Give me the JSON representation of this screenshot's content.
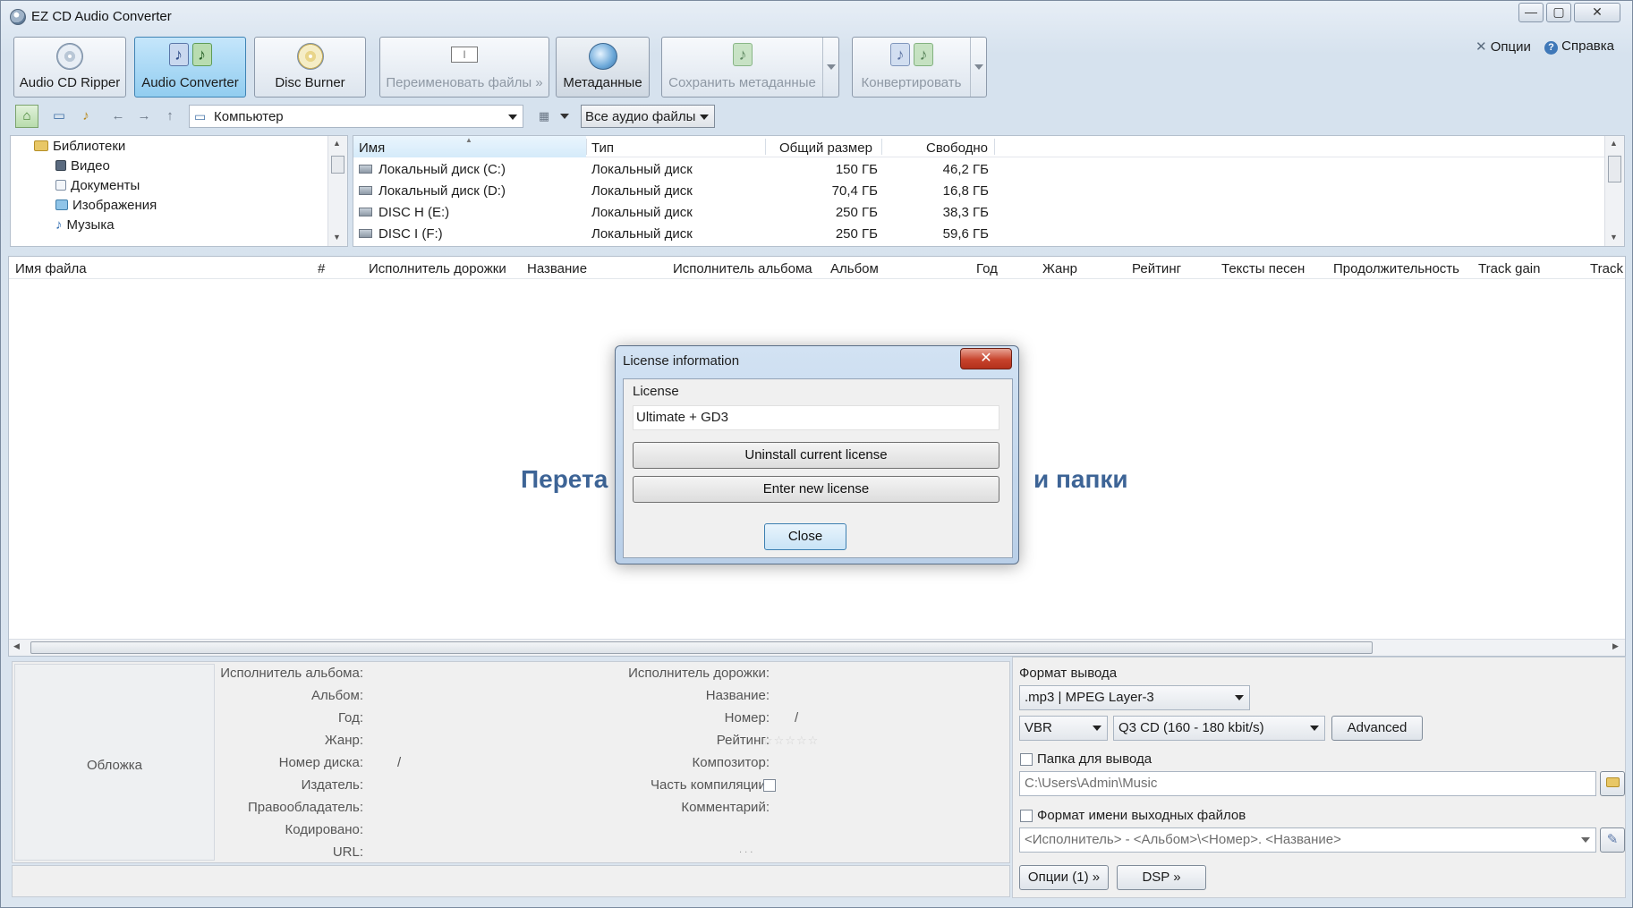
{
  "window": {
    "title": "EZ CD Audio Converter",
    "minimize": "—",
    "maximize": "▢",
    "close": "✕"
  },
  "toolbar": {
    "ripper": "Audio CD Ripper",
    "converter": "Audio Converter",
    "burner": "Disc Burner",
    "rename": "Переименовать файлы »",
    "metadata": "Метаданные",
    "save_metadata": "Сохранить метаданные",
    "convert": "Конвертировать",
    "options": "Опции",
    "help": "Справка"
  },
  "nav": {
    "back": "←",
    "forward": "→",
    "up": "↑",
    "location": "Компьютер",
    "filter": "Все аудио файлы"
  },
  "tree": {
    "items": [
      {
        "label": "Библиотеки",
        "icon": "libraries-icon"
      },
      {
        "label": "Видео",
        "icon": "video-icon"
      },
      {
        "label": "Документы",
        "icon": "documents-icon"
      },
      {
        "label": "Изображения",
        "icon": "images-icon"
      },
      {
        "label": "Музыка",
        "icon": "music-icon"
      }
    ]
  },
  "drives": {
    "headers": [
      "Имя",
      "Тип",
      "Общий размер",
      "Свободно"
    ],
    "rows": [
      {
        "name": "Локальный диск (C:)",
        "type": "Локальный диск",
        "total": "150 ГБ",
        "free": "46,2 ГБ"
      },
      {
        "name": "Локальный диск (D:)",
        "type": "Локальный диск",
        "total": "70,4 ГБ",
        "free": "16,8 ГБ"
      },
      {
        "name": "DISC H (E:)",
        "type": "Локальный диск",
        "total": "250 ГБ",
        "free": "38,3 ГБ"
      },
      {
        "name": "DISC I (F:)",
        "type": "Локальный диск",
        "total": "250 ГБ",
        "free": "59,6 ГБ"
      }
    ]
  },
  "filelist": {
    "headers": [
      "Имя файла",
      "#",
      "Исполнитель дорожки",
      "Название",
      "Исполнитель альбома",
      "Альбом",
      "Год",
      "Жанр",
      "Рейтинг",
      "Тексты песен",
      "Продолжительность",
      "Track gain",
      "Track"
    ],
    "drop_left": "Перета",
    "drop_right": "и папки"
  },
  "modal": {
    "title": "License information",
    "close": "✕",
    "license_label": "License",
    "license_value": "Ultimate + GD3",
    "uninstall": "Uninstall current license",
    "enter_new": "Enter new license",
    "close_button": "Close"
  },
  "metadata": {
    "cover": "Обложка",
    "left_labels": [
      "Исполнитель альбома:",
      "Альбом:",
      "Год:",
      "Жанр:",
      "Номер диска:",
      "Издатель:",
      "Правообладатель:",
      "Кодировано:",
      "URL:"
    ],
    "disc_slash": "/",
    "right_labels": [
      "Исполнитель дорожки:",
      "Название:",
      "Номер:",
      "Рейтинг:",
      "Композитор:",
      "Часть компиляции:",
      "Комментарий:"
    ],
    "number_slash": "/",
    "stars": "☆☆☆☆☆",
    "dots": ". . ."
  },
  "output": {
    "format_label": "Формат вывода",
    "format_value": ".mp3 | MPEG Layer-3",
    "mode_value": "VBR",
    "quality_value": "Q3  CD  (160 - 180 kbit/s)",
    "advanced": "Advanced",
    "folder_label": "Папка для вывода",
    "folder_value": "C:\\Users\\Admin\\Music",
    "filename_label": "Формат имени выходных файлов",
    "filename_value": "<Исполнитель> - <Альбом>\\<Номер>. <Название>",
    "options_button": "Опции (1) »",
    "dsp_button": "DSP »"
  }
}
